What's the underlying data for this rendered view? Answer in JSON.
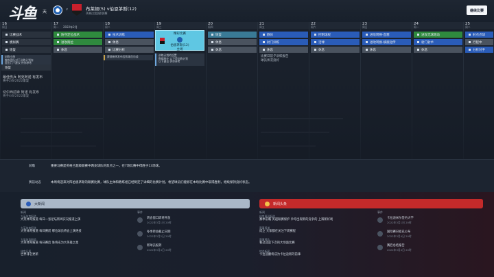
{
  "header": {
    "logo": "斗鱼",
    "logo_sub": "天",
    "vs": "v",
    "match_title": "布莱顿(5) v伯恩茅斯(12)",
    "match_sub": "英格兰超级联赛",
    "continue_label": "继续比赛"
  },
  "colors": {
    "accent": "#5fc7e3",
    "green": "#2f8a3e",
    "blue": "#2a5cb8",
    "red": "#c42a2a"
  },
  "calendar": {
    "days": [
      {
        "num": "16",
        "name": "周日",
        "slots": [
          "比赛战术",
          "模拟赛",
          "恢复"
        ]
      },
      {
        "num": "17",
        "name": "周一",
        "extra": "2022年2月",
        "slots": [
          "防守定位战术",
          "进攻跑位",
          "休息"
        ]
      },
      {
        "num": "18",
        "name": "周二",
        "slots": [
          "技术训练",
          "休息",
          "比赛分析"
        ]
      },
      {
        "num": "19",
        "name": "周三",
        "slots": []
      },
      {
        "num": "20",
        "name": "周四",
        "slots": [
          "恢复",
          "休息",
          "休息"
        ]
      },
      {
        "num": "21",
        "name": "周五",
        "slots": [
          "静体",
          "射门训练",
          "休息"
        ]
      },
      {
        "num": "22",
        "name": "周六",
        "slots": [
          "控制球权",
          "活球",
          "休息"
        ]
      },
      {
        "num": "23",
        "name": "周日",
        "slots": [
          "进攻转换-直塞",
          "进攻转换-横敲短传",
          "休息"
        ]
      },
      {
        "num": "24",
        "name": "周一",
        "slots": [
          "进攻无球跑动",
          "射门射术",
          "休息"
        ]
      },
      {
        "num": "25",
        "name": "周二",
        "slots": [
          "射点点球",
          "行程中",
          "分析对手"
        ]
      }
    ],
    "match_card": {
      "label": "精彩比赛",
      "team": "伯恩茅斯(12)",
      "venue": "主场"
    },
    "notes": {
      "box1": [
        "训练小结",
        "教练团队对于训练计划有",
        "提出几个建议 供你参考"
      ],
      "box1_tag": "恢复",
      "mid1": "赛前新闻发布会和球员访谈",
      "mid2": [
        "训练计划的设置",
        "数据统计 以下是训练计划",
        "以下建议 供你参考"
      ],
      "right1": [
        "比赛日前夕训练报告",
        "球员状况良好"
      ],
      "injury1_title": "最佳伤兵 阿克阿诺 有发布",
      "injury1_date": "将于2/6/2022康复",
      "injury2_title": "切尔西前锋 阿诺 有发布",
      "injury2_date": "将于4/6/2022康复"
    }
  },
  "news": {
    "label1": "前瞻",
    "text1": "重要马赛是英格兰超级联赛中两支球队的焦点之一，在7场比赛中得胜于13场球。",
    "label2": "赛前动态",
    "text2": "本周将迎来对阵伯恩茅斯的联赛比赛，球队主帅和教练组已经制定了详细的比赛计划，希望球员们能够在本场比赛中取得胜利，继续保持良好状态。"
  },
  "left_panel": {
    "title": "大新闻",
    "col1": "新闻",
    "col2": "事件",
    "items": [
      {
        "src": "大英体育报道",
        "text": "大英体育报道 每日一张足坛新闻实况报道上演"
      },
      {
        "src": "大英体育报道",
        "text": "大英体育报道 每日赛前 哪位球员将会上演绝技"
      },
      {
        "src": "大英体育报道",
        "text": "大英体育报道 每日赛后 谁将成为大英雄之星"
      },
      {
        "src": "体育日报",
        "text": "世界排名更新"
      }
    ],
    "records": [
      {
        "title": "转会窗口即将开放",
        "date": "2022年3月1日 20时"
      },
      {
        "title": "冬季转会截止日期",
        "date": "2022年3月2日 20时"
      },
      {
        "title": "新球员报到",
        "date": "2022年3月4日 20时"
      }
    ]
  },
  "right_panel": {
    "title": "新闻头条",
    "col1": "新闻",
    "col2": "事件",
    "items": [
      {
        "src": "体育周刊报道",
        "text": "赛季前瞻 英超联赛保护 争夺出现新的竞争的 上演新好戏"
      },
      {
        "src": "赛事报道",
        "text": "成立 大家都在关注下周赛程"
      },
      {
        "src": "赛事预告",
        "text": "看过还是下次的大场面比赛"
      },
      {
        "src": "转会新闻",
        "text": "卡拉迪翻将成为卡拉迪新的前锋"
      }
    ],
    "records": [
      {
        "title": "卡拉迪米尔签约大学",
        "date": "2022年3月1日 20时"
      },
      {
        "title": "国际赛日程已公布",
        "date": "2022年3月4日 20时"
      },
      {
        "title": "赛后总结报告",
        "date": "2022年3月4日 20时"
      }
    ]
  }
}
